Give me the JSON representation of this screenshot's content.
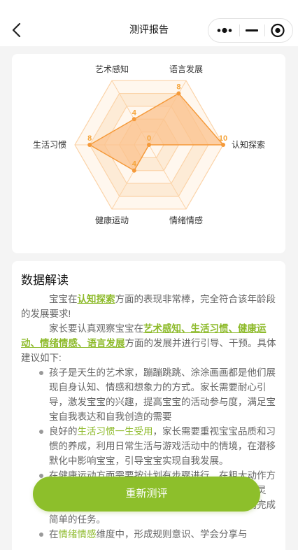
{
  "nav": {
    "title": "测评报告",
    "back_icon": "chevron-left-icon",
    "more_icon": "more-dots-icon",
    "minimize_icon": "minimize-icon",
    "close_icon": "target-close-icon"
  },
  "chart_data": {
    "type": "radar",
    "max": 10,
    "axes": [
      "语言发展",
      "认知探索",
      "情绪情感",
      "健康运动",
      "生活习惯",
      "艺术感知"
    ],
    "values": [
      8,
      10,
      0,
      4,
      8,
      4
    ],
    "colors": {
      "grid_fill": "#fdebd6",
      "grid_stroke": "#fbd3a8",
      "data_fill": "#fbc28c",
      "data_stroke": "#f59a3a",
      "label": "#333333",
      "value": "#f5a43a"
    }
  },
  "report": {
    "section_title": "数据解读",
    "p1_pre": "宝宝在",
    "p1_hl": "认知探索",
    "p1_post": "方面的表现非常棒，完全符合该年龄段的发展要求!",
    "p2_pre": "家长要认真观察宝宝在",
    "p2_hl": "艺术感知、生活习惯、健康运动、情绪情感、语言发展",
    "p2_post": "方面的发展并进行引导、干预。具体建议如下:",
    "tips": [
      {
        "pre": "",
        "hl": "",
        "post": "孩子是天生的艺术家，蹦蹦跳跳、涂涂画画都是他们展现自身认知、情感和想象力的方式。家长需要耐心引导，激发宝宝的兴趣，提高宝宝的活动参与度，满足宝宝自我表达和自我创造的需要"
      },
      {
        "pre": "良好的",
        "hl": "生活习惯一生受用",
        "post": "，家长需要重视宝宝品质和习惯的养成，利用日常生活与游戏活动中的情境，在潜移默化中影响宝宝，引导宝宝实现自我发展。"
      },
      {
        "pre": "",
        "hl": "",
        "post": "在健康运动方面需要按计划有步骤进行，在粗大动作方面，有意识地让宝宝多接触，促进身体动作协调、灵敏；在精细动作方面，宝宝要能够控制手部小肌肉完成简单的任务。"
      },
      {
        "pre": "在",
        "hl": "情绪情感",
        "post": "维度中，形成规则意识、学会分享与"
      }
    ]
  },
  "actions": {
    "redo_label": "重新测评"
  }
}
